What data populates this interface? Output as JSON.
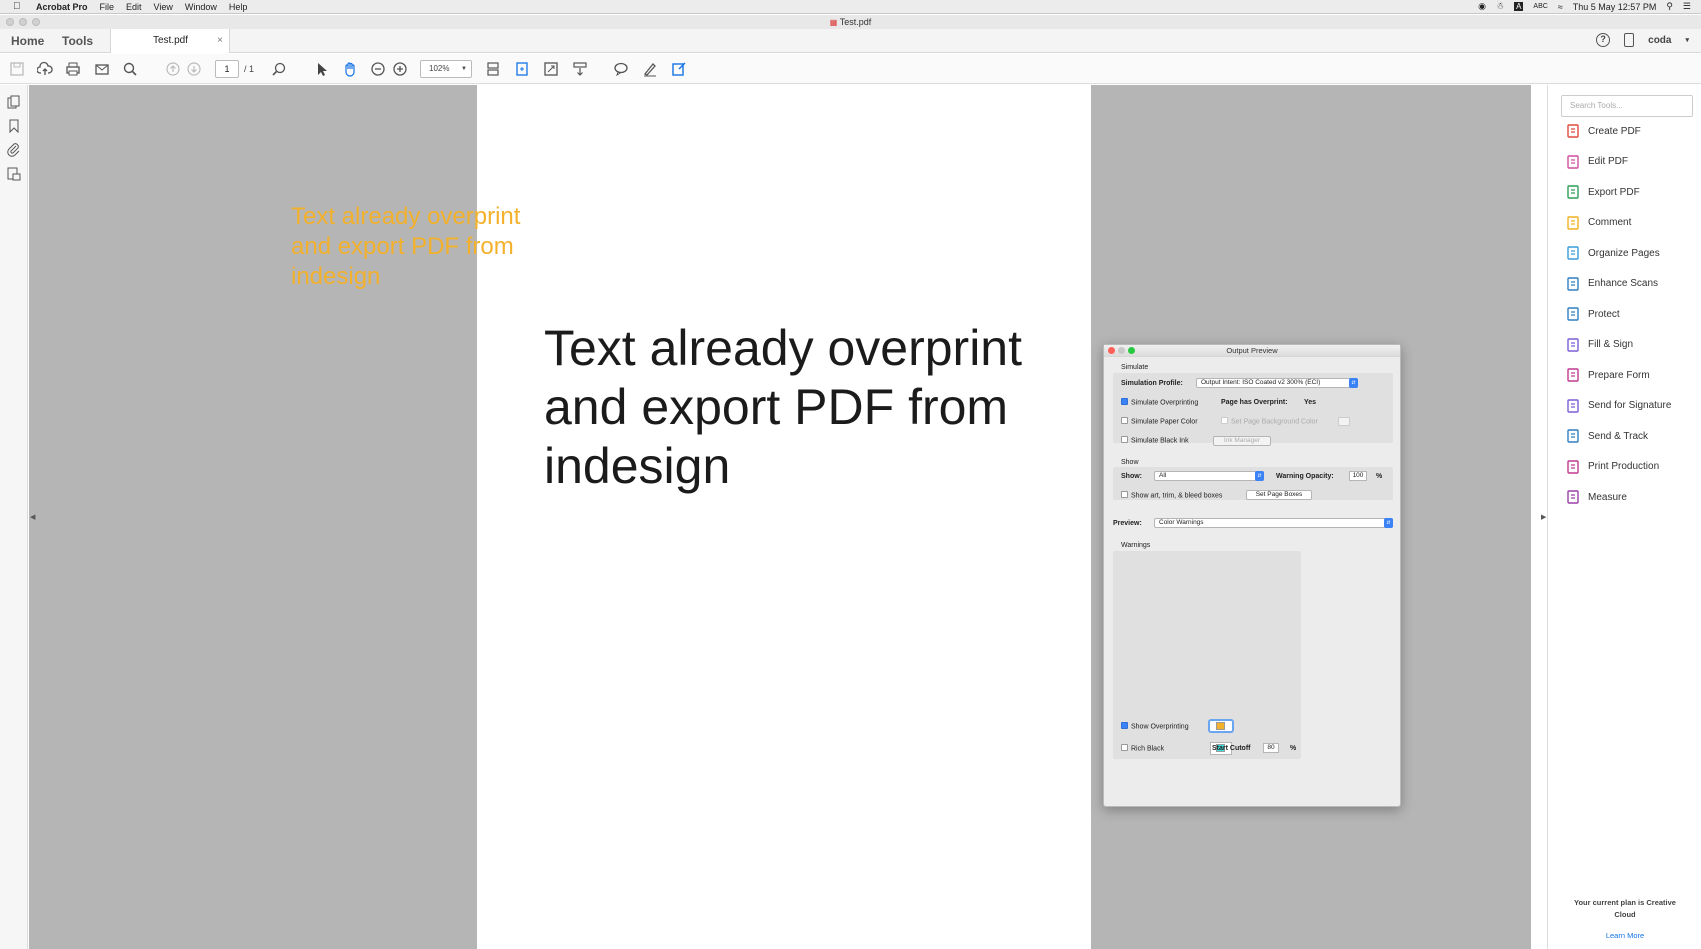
{
  "menubar": {
    "app_name": "Acrobat Pro",
    "items": [
      "File",
      "Edit",
      "View",
      "Window",
      "Help"
    ],
    "input_source": "ABC",
    "clock": "Thu 5 May  12:57 PM"
  },
  "window": {
    "title": "Test.pdf"
  },
  "tabbar": {
    "home": "Home",
    "tools": "Tools",
    "doc_tab": "Test.pdf",
    "close": "×",
    "user": "coda"
  },
  "toolbar": {
    "page_current": "1",
    "page_total": "/ 1",
    "zoom": "102%"
  },
  "document": {
    "main_text": "Text already overprint and export PDF from indesign",
    "overprint_text": "Text already overprint and export PDF from indesign"
  },
  "output_preview": {
    "title": "Output Preview",
    "simulate_heading": "Simulate",
    "simulation_profile_label": "Simulation Profile:",
    "simulation_profile_value": "Output Intent: ISO Coated v2 300% (ECI)",
    "simulate_overprinting": "Simulate Overprinting",
    "page_has_overprint_label": "Page has Overprint:",
    "page_has_overprint_value": "Yes",
    "simulate_paper_color": "Simulate Paper Color",
    "set_page_bg_color": "Set Page Background Color",
    "simulate_black_ink": "Simulate Black Ink",
    "ink_manager": "Ink Manager",
    "show_heading": "Show",
    "show_label": "Show:",
    "show_value": "All",
    "warning_opacity_label": "Warning Opacity:",
    "warning_opacity_value": "100",
    "percent": "%",
    "show_boxes": "Show art, trim, & bleed boxes",
    "set_page_boxes": "Set Page Boxes",
    "preview_label": "Preview:",
    "preview_value": "Color Warnings",
    "warnings_heading": "Warnings",
    "show_overprinting": "Show Overprinting",
    "rich_black": "Rich Black",
    "start_cutoff_label": "Start Cutoff",
    "start_cutoff_value": "80",
    "overprint_swatch_color": "#f3b12c",
    "rich_black_swatch_color": "#3fe0e0"
  },
  "tools_pane": {
    "search_placeholder": "Search Tools...",
    "tools": [
      {
        "label": "Create PDF",
        "icon": "create-pdf-icon",
        "color": "#e04a3f"
      },
      {
        "label": "Edit PDF",
        "icon": "edit-pdf-icon",
        "color": "#d04ea0"
      },
      {
        "label": "Export PDF",
        "icon": "export-pdf-icon",
        "color": "#2f9e57"
      },
      {
        "label": "Comment",
        "icon": "comment-icon",
        "color": "#f2b01e"
      },
      {
        "label": "Organize Pages",
        "icon": "organize-pages-icon",
        "color": "#3a9ad9"
      },
      {
        "label": "Enhance Scans",
        "icon": "enhance-scans-icon",
        "color": "#2f7fc1"
      },
      {
        "label": "Protect",
        "icon": "protect-icon",
        "color": "#2f7fc1"
      },
      {
        "label": "Fill & Sign",
        "icon": "fill-sign-icon",
        "color": "#7b5ed6"
      },
      {
        "label": "Prepare Form",
        "icon": "prepare-form-icon",
        "color": "#c0398f"
      },
      {
        "label": "Send for Signature",
        "icon": "send-signature-icon",
        "color": "#7b5ed6"
      },
      {
        "label": "Send & Track",
        "icon": "send-track-icon",
        "color": "#2f7fc1"
      },
      {
        "label": "Print Production",
        "icon": "print-production-icon",
        "color": "#c0398f"
      },
      {
        "label": "Measure",
        "icon": "measure-icon",
        "color": "#9b3fa8"
      }
    ],
    "plan_text": "Your current plan is Creative Cloud",
    "learn_more": "Learn More"
  }
}
